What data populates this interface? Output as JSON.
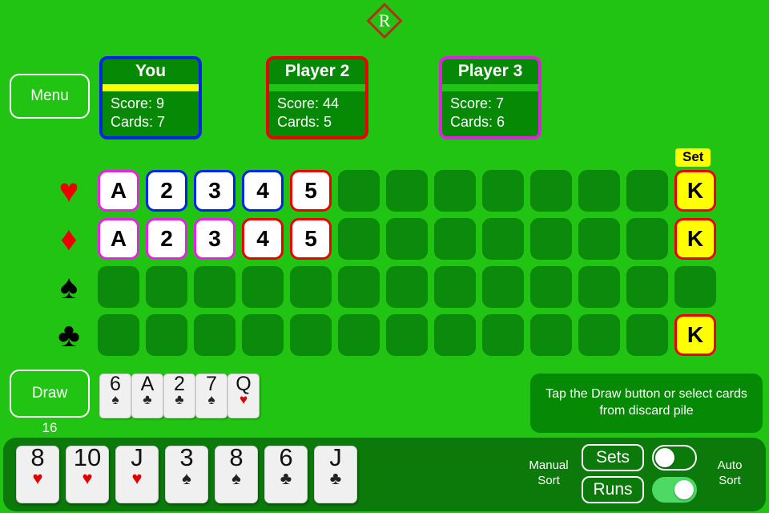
{
  "logo": {
    "letter": "R",
    "icon": "diamond-outline-icon"
  },
  "menu": {
    "label": "Menu"
  },
  "players": [
    {
      "name": "You",
      "score_label": "Score: 9",
      "cards_label": "Cards: 7",
      "border_color": "#0022ee",
      "active": true
    },
    {
      "name": "Player 2",
      "score_label": "Score: 44",
      "cards_label": "Cards: 5",
      "border_color": "#ee0000",
      "active": false
    },
    {
      "name": "Player 3",
      "score_label": "Score: 7",
      "cards_label": "Cards: 6",
      "border_color": "#e020e0",
      "active": false
    }
  ],
  "melds": {
    "set_badge": "Set",
    "columns": 13,
    "rows": [
      {
        "suit": "hearts",
        "suit_glyph": "♥",
        "suit_color": "red",
        "cells": [
          {
            "rank": "A",
            "style": "b-magenta"
          },
          {
            "rank": "2",
            "style": "b-blue"
          },
          {
            "rank": "3",
            "style": "b-blue"
          },
          {
            "rank": "4",
            "style": "b-blue"
          },
          {
            "rank": "5",
            "style": "b-red"
          },
          null,
          null,
          null,
          null,
          null,
          null,
          null,
          {
            "rank": "K",
            "style": "yellow"
          }
        ]
      },
      {
        "suit": "diamonds",
        "suit_glyph": "♦",
        "suit_color": "red",
        "cells": [
          {
            "rank": "A",
            "style": "b-magenta"
          },
          {
            "rank": "2",
            "style": "b-magenta"
          },
          {
            "rank": "3",
            "style": "b-magenta"
          },
          {
            "rank": "4",
            "style": "b-red"
          },
          {
            "rank": "5",
            "style": "b-red"
          },
          null,
          null,
          null,
          null,
          null,
          null,
          null,
          {
            "rank": "K",
            "style": "yellow"
          }
        ]
      },
      {
        "suit": "spades",
        "suit_glyph": "♠",
        "suit_color": "black",
        "cells": [
          null,
          null,
          null,
          null,
          null,
          null,
          null,
          null,
          null,
          null,
          null,
          null,
          null
        ]
      },
      {
        "suit": "clubs",
        "suit_glyph": "♣",
        "suit_color": "black",
        "cells": [
          null,
          null,
          null,
          null,
          null,
          null,
          null,
          null,
          null,
          null,
          null,
          null,
          {
            "rank": "K",
            "style": "yellow"
          }
        ]
      }
    ]
  },
  "draw": {
    "label": "Draw",
    "count": "16"
  },
  "discard": [
    {
      "rank": "6",
      "suit_glyph": "♠",
      "suit_color": "black"
    },
    {
      "rank": "A",
      "suit_glyph": "♣",
      "suit_color": "black"
    },
    {
      "rank": "2",
      "suit_glyph": "♣",
      "suit_color": "black"
    },
    {
      "rank": "7",
      "suit_glyph": "♠",
      "suit_color": "black"
    },
    {
      "rank": "Q",
      "suit_glyph": "♥",
      "suit_color": "red"
    }
  ],
  "hint": {
    "text": "Tap the Draw button or select cards from discard pile"
  },
  "hand": [
    {
      "rank": "8",
      "suit_glyph": "♥",
      "suit_color": "red"
    },
    {
      "rank": "10",
      "suit_glyph": "♥",
      "suit_color": "red"
    },
    {
      "rank": "J",
      "suit_glyph": "♥",
      "suit_color": "red"
    },
    {
      "rank": "3",
      "suit_glyph": "♠",
      "suit_color": "black"
    },
    {
      "rank": "8",
      "suit_glyph": "♠",
      "suit_color": "black"
    },
    {
      "rank": "6",
      "suit_glyph": "♣",
      "suit_color": "black"
    },
    {
      "rank": "J",
      "suit_glyph": "♣",
      "suit_color": "black"
    }
  ],
  "sort": {
    "manual_label_line1": "Manual",
    "manual_label_line2": "Sort",
    "auto_label_line1": "Auto",
    "auto_label_line2": "Sort",
    "sets_label": "Sets",
    "runs_label": "Runs",
    "sets_auto": false,
    "runs_auto": true
  },
  "colors": {
    "table_green": "#22c413",
    "slot_green": "#0b8a0b",
    "panel_green": "#068a06",
    "bar_green": "#0b7a0b",
    "active_yellow": "#ffff00",
    "card_red": "#ee0000",
    "card_blue": "#0022ee",
    "card_magenta": "#e820e8"
  }
}
